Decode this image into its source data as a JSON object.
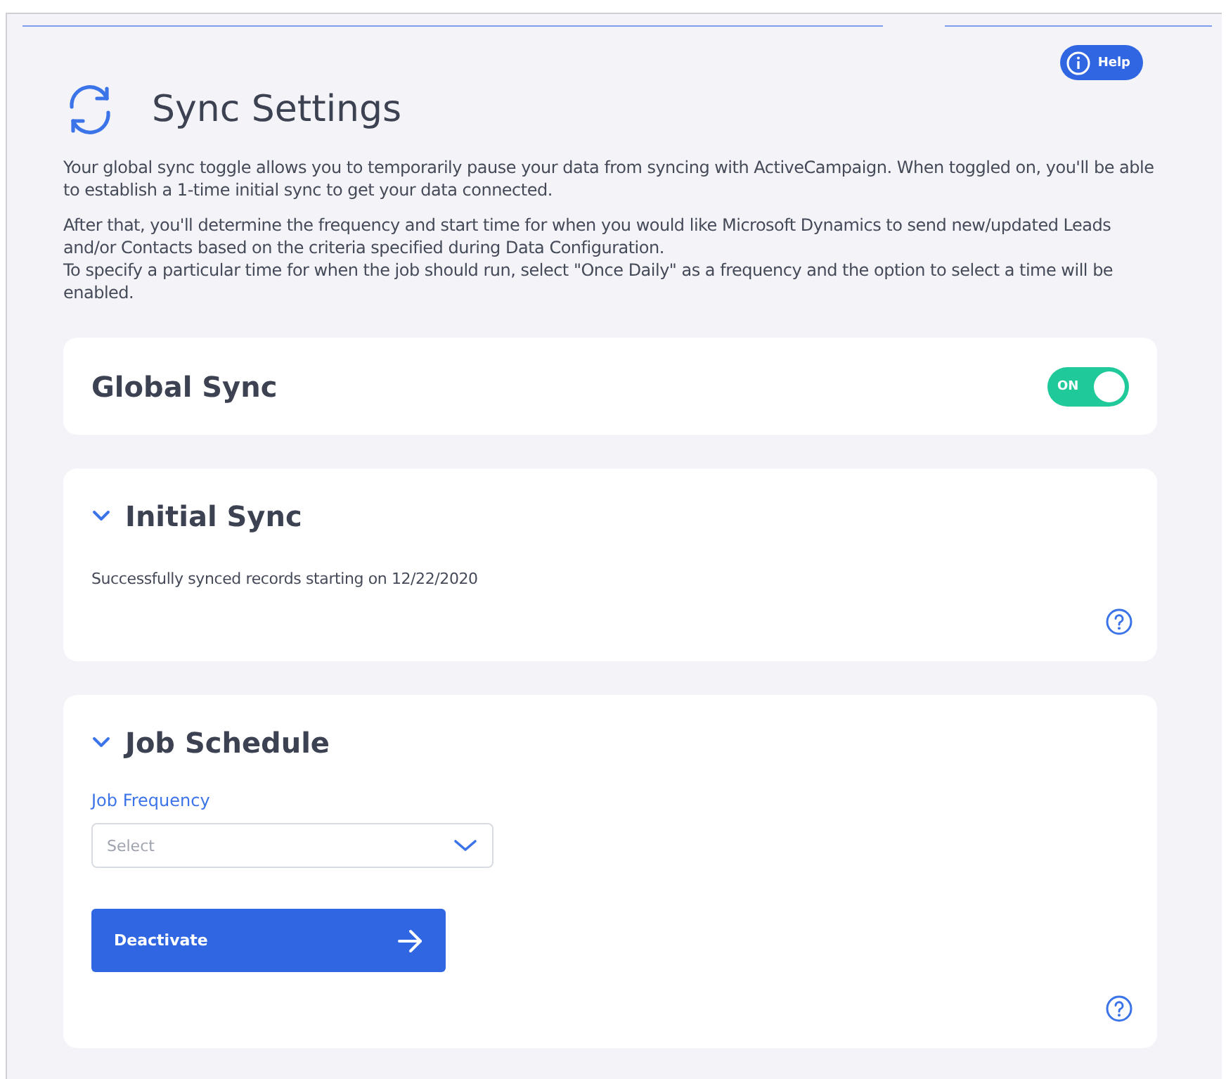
{
  "help_button": {
    "label": "Help"
  },
  "title": "Sync Settings",
  "intro": [
    "Your global sync toggle allows you to temporarily pause your data from syncing with ActiveCampaign. When toggled on, you'll be able to establish a 1-time initial sync to get your data connected.",
    "After that, you'll determine the frequency and start time for when you would like Microsoft Dynamics to send new/updated Leads and/or Contacts based on the criteria specified during Data Configuration.\nTo specify a particular time for when the job should run, select \"Once Daily\" as a frequency and the option to select a time will be enabled."
  ],
  "sections": [
    {
      "kind": "toggle",
      "title": "Global Sync",
      "toggle": {
        "label": "ON",
        "on": true
      }
    },
    {
      "kind": "collapsible",
      "title": "Initial Sync",
      "expanded": true,
      "text": "Successfully synced records starting on 12/22/2020",
      "help_icon": true
    },
    {
      "kind": "collapsible",
      "title": "Job Schedule",
      "expanded": true,
      "field": {
        "label": "Job Frequency",
        "placeholder": "Select"
      },
      "button": {
        "label": "Deactivate"
      },
      "help_icon": true
    }
  ]
}
